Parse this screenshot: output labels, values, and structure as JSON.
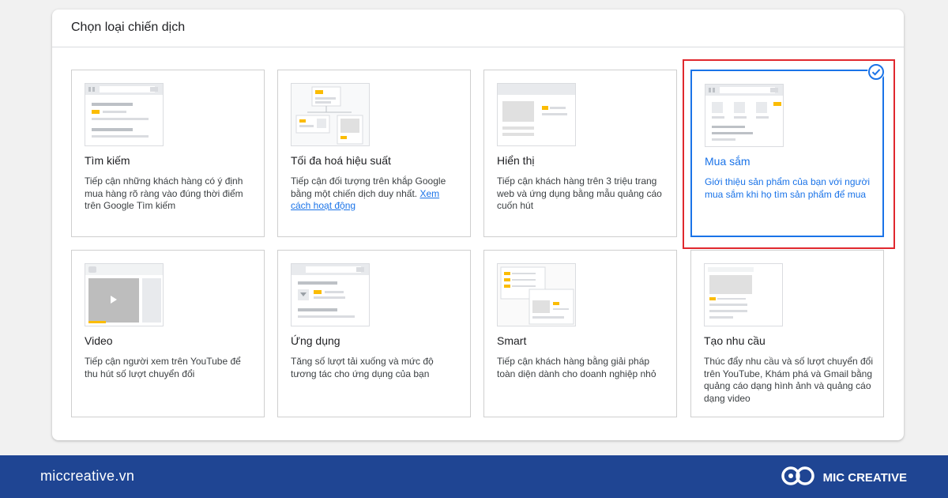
{
  "panel": {
    "title": "Chọn loại chiến dịch"
  },
  "cards": [
    {
      "title": "Tìm kiếm",
      "desc": "Tiếp cận những khách hàng có ý định mua hàng rõ ràng vào đúng thời điểm trên Google Tìm kiếm",
      "icon": "search-campaign-icon",
      "selected": false
    },
    {
      "title": "Tối đa hoá hiệu suất",
      "desc": "Tiếp cận đối tượng trên khắp Google bằng một chiến dịch duy nhất.",
      "link": "Xem cách hoạt động",
      "icon": "performance-max-icon",
      "selected": false
    },
    {
      "title": "Hiển thị",
      "desc": "Tiếp cận khách hàng trên 3 triệu trang web và ứng dụng bằng mẫu quảng cáo cuốn hút",
      "icon": "display-campaign-icon",
      "selected": false
    },
    {
      "title": "Mua sắm",
      "desc": "Giới thiệu sản phẩm của bạn với người mua sắm khi họ tìm sản phẩm để mua",
      "icon": "shopping-campaign-icon",
      "selected": true
    },
    {
      "title": "Video",
      "desc": "Tiếp cận người xem trên YouTube để thu hút số lượt chuyển đổi",
      "icon": "video-campaign-icon",
      "selected": false
    },
    {
      "title": "Ứng dụng",
      "desc": "Tăng số lượt tải xuống và mức độ tương tác cho ứng dụng của bạn",
      "icon": "app-campaign-icon",
      "selected": false
    },
    {
      "title": "Smart",
      "desc": "Tiếp cận khách hàng bằng giải pháp toàn diện dành cho doanh nghiệp nhỏ",
      "icon": "smart-campaign-icon",
      "selected": false
    },
    {
      "title": "Tạo nhu cầu",
      "desc": "Thúc đẩy nhu cầu và số lượt chuyển đổi trên YouTube, Khám phá và Gmail bằng quảng cáo dạng hình ảnh và quảng cáo dạng video",
      "icon": "demand-gen-icon",
      "selected": false
    }
  ],
  "footer": {
    "url": "miccreative.vn",
    "brand": "MIC CREATIVE"
  },
  "colors": {
    "accent": "#1a73e8",
    "ad_yellow": "#fbbc04",
    "highlight": "#e0282e",
    "footer_bg": "#1f4593"
  }
}
